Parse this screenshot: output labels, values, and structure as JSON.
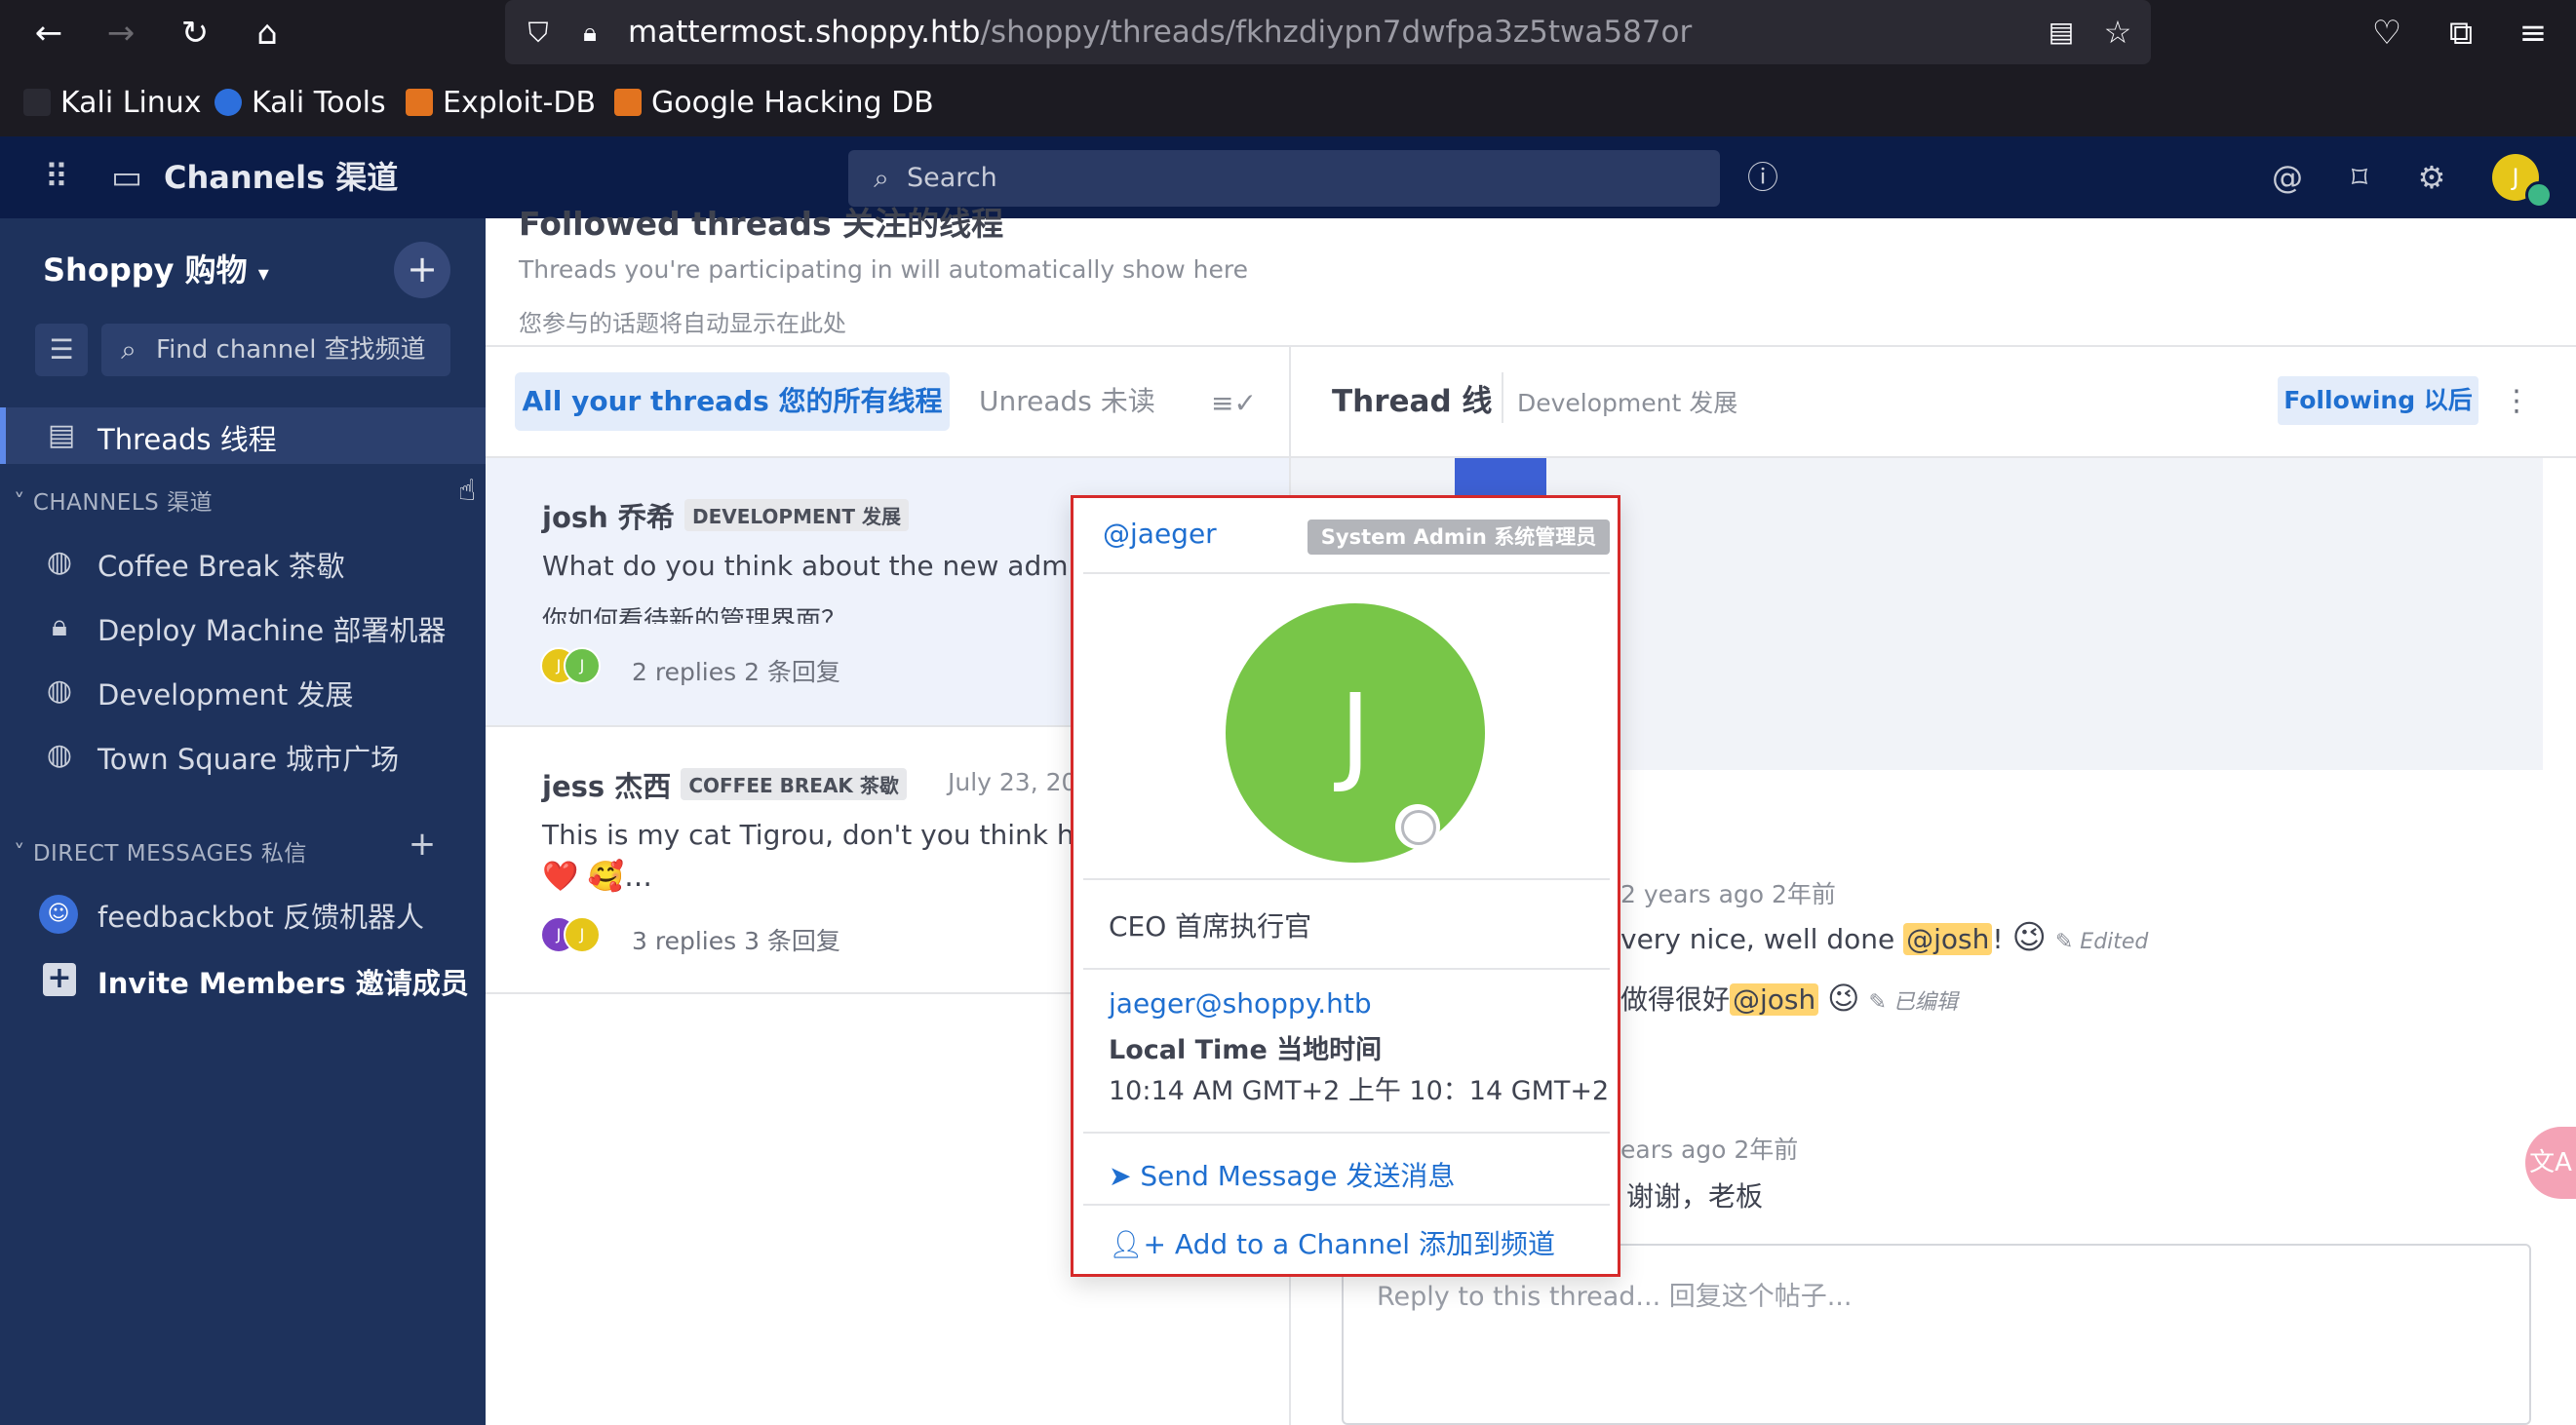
{
  "browser": {
    "url_host": "mattermost.shoppy.htb",
    "url_path": "/shoppy/threads/fkhzdiypn7dwfpa3z5twa587or",
    "bookmarks": [
      "Kali Linux",
      "Kali Tools",
      "Exploit-DB",
      "Google Hacking DB"
    ]
  },
  "header": {
    "app_title": "Channels 渠道",
    "search_placeholder": "Search",
    "avatar_letter": "J"
  },
  "sidebar": {
    "team_name": "Shoppy 购物",
    "find_channel": "Find channel 查找频道",
    "threads_label": "Threads 线程",
    "channels_header": "CHANNELS 渠道",
    "channels": [
      "Coffee Break 茶歇",
      "Deploy Machine 部署机器",
      "Development 发展",
      "Town Square 城市广场"
    ],
    "dm_header": "DIRECT MESSAGES 私信",
    "dms": [
      "feedbackbot 反馈机器人"
    ],
    "invite_label": "Invite Members 邀请成员"
  },
  "threads_page": {
    "title": "Followed threads 关注的线程",
    "subtitle_en": "Threads you're participating in will automatically show here",
    "subtitle_zh": "您参与的话题将自动显示在此处",
    "tab_all": "All your threads 您的所有线程",
    "tab_unreads": "Unreads 未读",
    "items": [
      {
        "author": "josh 乔希",
        "channel_tag": "DEVELOPMENT 发展",
        "line1": "What do you think about the new admin",
        "line2": "你如何看待新的管理界面？",
        "replies": "2 replies 2 条回复",
        "avatars": [
          "J",
          "J"
        ],
        "avatar_colors": [
          "#e6c619",
          "#6cc04a"
        ]
      },
      {
        "author": "jess 杰西",
        "channel_tag": "COFFEE BREAK 茶歇",
        "date": "July 23, 202",
        "line1": "This is my cat Tigrou, don't you think he's",
        "line2": "❤️ 🥰...",
        "replies": "3 replies 3 条回复",
        "avatars": [
          "J",
          "J"
        ],
        "avatar_colors": [
          "#7b3fc4",
          "#e6c619"
        ]
      }
    ]
  },
  "thread_panel": {
    "title": "Thread 线",
    "channel": "Development 发展",
    "following_label": "Following 以后",
    "msg1_time": "2 years ago 2年前",
    "msg1_text_en_pre": "very nice, well done",
    "msg1_mention": "@josh",
    "msg1_text_en_post": "!",
    "edited_en": "Edited",
    "msg1_text_zh_pre": "做得很好",
    "edited_zh": "已编辑",
    "msg2_time": "ears ago 2年前",
    "msg2_text": "谢谢，老板",
    "reply_placeholder": "Reply to this thread... 回复这个帖子..."
  },
  "profile_popover": {
    "username": "@jaeger",
    "role_badge": "System Admin 系统管理员",
    "avatar_letter": "J",
    "avatar_color": "#78c648",
    "position": "CEO 首席执行官",
    "email": "jaeger@shoppy.htb",
    "local_time_label": "Local Time 当地时间",
    "local_time_value": "10:14 AM GMT+2 上午 10：14 GMT+2",
    "send_message": "Send Message 发送消息",
    "add_to_channel": "Add to a Channel 添加到频道"
  }
}
